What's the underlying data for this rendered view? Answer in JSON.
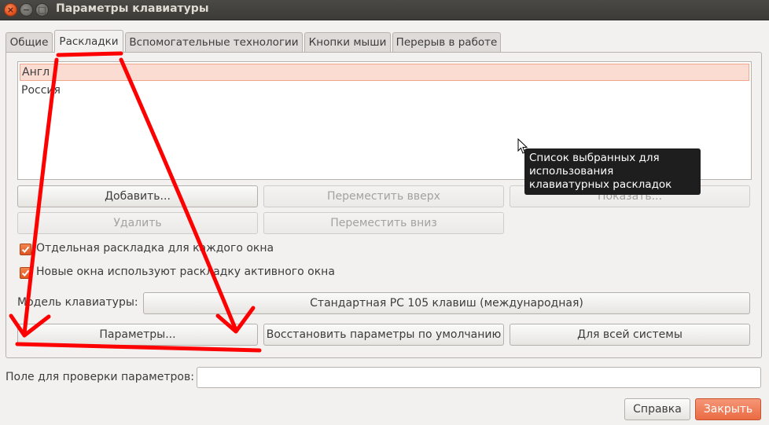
{
  "window": {
    "title": "Параметры клавиатуры",
    "close_glyph": "×",
    "minimize_glyph": "−",
    "maximize_glyph": "□"
  },
  "tabs": [
    {
      "label": "Общие",
      "active": false
    },
    {
      "label": "Раскладки",
      "active": true
    },
    {
      "label": "Вспомогательные технологии",
      "active": false
    },
    {
      "label": "Кнопки мыши",
      "active": false
    },
    {
      "label": "Перерыв в работе",
      "active": false
    }
  ],
  "layouts": {
    "items": [
      {
        "label": "Англ",
        "selected": true
      },
      {
        "label": "Россия",
        "selected": false
      }
    ],
    "tooltip": "Список выбранных для использования клавиатурных раскладок"
  },
  "buttons": {
    "add": "Добавить...",
    "move_up": "Переместить вверх",
    "show": "Показать...",
    "remove": "Удалить",
    "move_down": "Переместить вниз",
    "options": "Параметры...",
    "reset": "Восстановить параметры по умолчанию",
    "system_wide": "Для всей системы",
    "help": "Справка",
    "close": "Закрыть"
  },
  "checkboxes": [
    {
      "label": "Отдельная раскладка для каждого окна",
      "checked": true
    },
    {
      "label": "Новые окна используют раскладку активного окна",
      "checked": true
    }
  ],
  "keyboard_model": {
    "label": "Модель клавиатуры:",
    "value": "Стандартная PC 105 клавиш (международная)"
  },
  "test_field": {
    "label": "Поле для проверки параметров:",
    "value": ""
  },
  "colors": {
    "accent": "#e95420",
    "selection_bg": "#fbdcd2",
    "annotation": "#ff0000",
    "titlebar": "#3c3b37"
  }
}
